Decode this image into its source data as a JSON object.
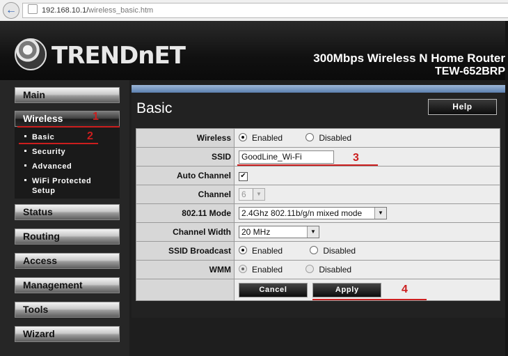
{
  "browser": {
    "url_host": "192.168.10.1/",
    "url_path": "wireless_basic.htm"
  },
  "header": {
    "logo_text": "TRENDnET",
    "model_desc": "300Mbps Wireless N Home Router",
    "model_code": "TEW-652BRP"
  },
  "sidebar": {
    "main": "Main",
    "wireless": "Wireless",
    "submenu": [
      "Basic",
      "Security",
      "Advanced",
      "WiFi Protected",
      "Setup"
    ],
    "status": "Status",
    "routing": "Routing",
    "access": "Access",
    "management": "Management",
    "tools": "Tools",
    "wizard": "Wizard"
  },
  "annotations": [
    "1",
    "2",
    "3",
    "4"
  ],
  "page": {
    "title": "Basic",
    "help": "Help"
  },
  "form": {
    "wireless": {
      "label": "Wireless",
      "enabled": "Enabled",
      "disabled": "Disabled"
    },
    "ssid": {
      "label": "SSID",
      "value": "GoodLine_Wi-Fi"
    },
    "auto_channel": {
      "label": "Auto Channel",
      "checked": "✔"
    },
    "channel": {
      "label": "Channel",
      "value": "6"
    },
    "mode": {
      "label": "802.11 Mode",
      "value": "2.4Ghz 802.11b/g/n mixed mode"
    },
    "width": {
      "label": "Channel Width",
      "value": "20 MHz"
    },
    "broadcast": {
      "label": "SSID Broadcast",
      "enabled": "Enabled",
      "disabled": "Disabled"
    },
    "wmm": {
      "label": "WMM",
      "enabled": "Enabled",
      "disabled": "Disabled"
    },
    "cancel": "Cancel",
    "apply": "Apply"
  },
  "colors": {
    "annotation_red": "#cc1e1e",
    "panel_accent": "#5d81b0"
  }
}
